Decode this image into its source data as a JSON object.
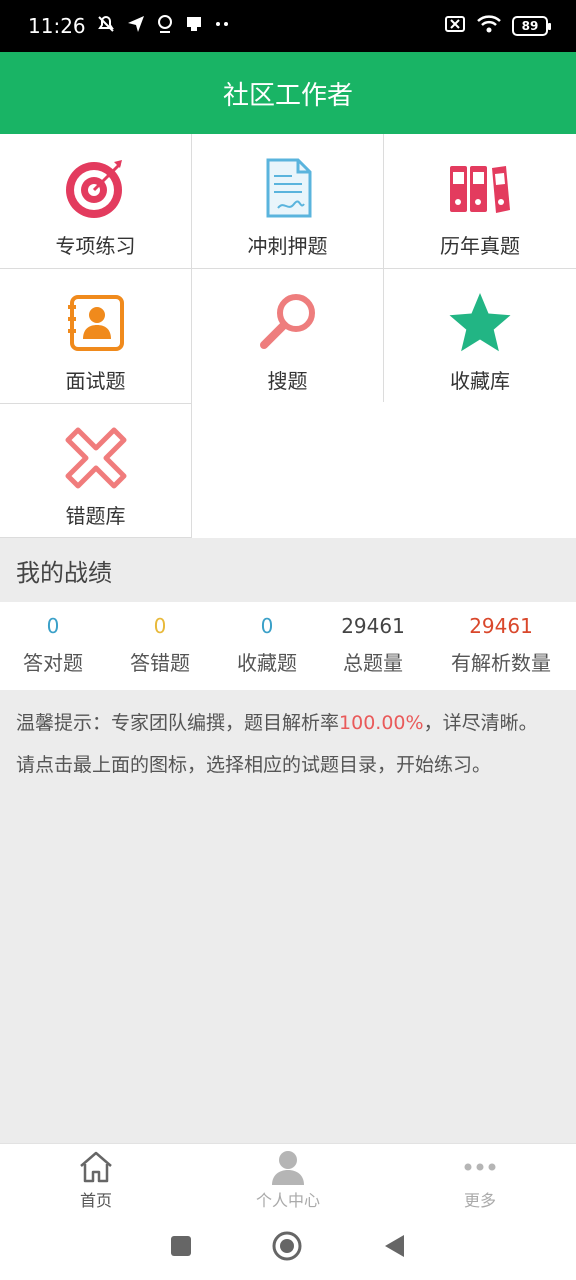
{
  "status_bar": {
    "time": "11:26",
    "battery": "89"
  },
  "header": {
    "title": "社区工作者"
  },
  "grid": {
    "items": [
      {
        "label": "专项练习",
        "icon": "target-icon"
      },
      {
        "label": "冲刺押题",
        "icon": "document-sign-icon"
      },
      {
        "label": "历年真题",
        "icon": "binders-icon"
      },
      {
        "label": "面试题",
        "icon": "contact-book-icon"
      },
      {
        "label": "搜题",
        "icon": "search-icon"
      },
      {
        "label": "收藏库",
        "icon": "star-icon"
      },
      {
        "label": "错题库",
        "icon": "cross-icon"
      }
    ]
  },
  "record": {
    "title": "我的战绩",
    "stats": [
      {
        "value": "0",
        "label": "答对题",
        "color": "#3aa0c8"
      },
      {
        "value": "0",
        "label": "答错题",
        "color": "#e8b93a"
      },
      {
        "value": "0",
        "label": "收藏题",
        "color": "#3aa0c8"
      },
      {
        "value": "29461",
        "label": "总题量",
        "color": "#444444"
      },
      {
        "value": "29461",
        "label": "有解析数量",
        "color": "#d9472b"
      }
    ]
  },
  "tips": {
    "line1_prefix": "温馨提示：专家团队编撰，题目解析率",
    "rate": "100.00%",
    "line1_suffix": "，详尽清晰。",
    "line2": "请点击最上面的图标，选择相应的试题目录，开始练习。"
  },
  "tabbar": {
    "items": [
      {
        "label": "首页",
        "icon": "home-icon",
        "color": "#555555"
      },
      {
        "label": "个人中心",
        "icon": "person-icon",
        "color": "#aaaaaa"
      },
      {
        "label": "更多",
        "icon": "more-icon",
        "color": "#aaaaaa"
      }
    ]
  },
  "colors": {
    "brand": "#19b465"
  }
}
